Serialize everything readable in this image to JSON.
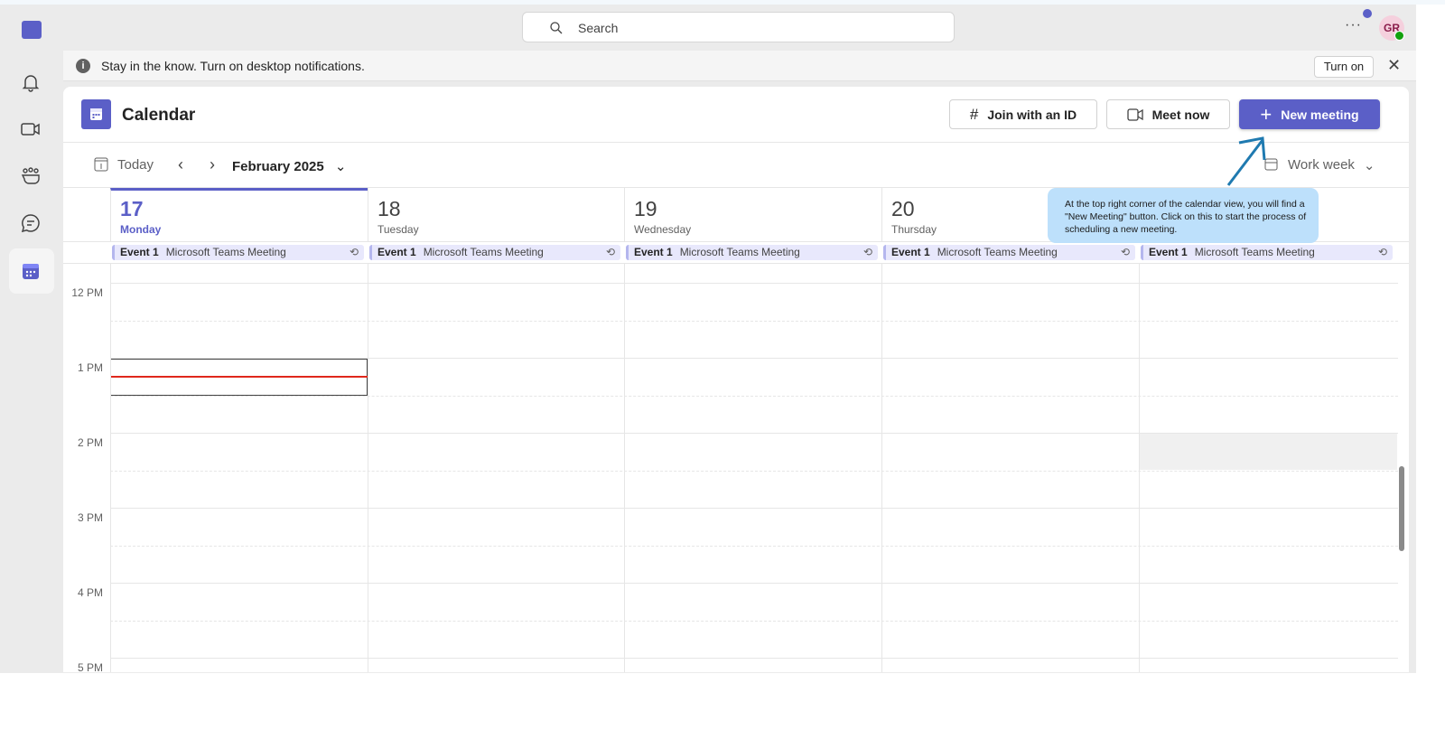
{
  "topbar": {
    "search_placeholder": "Search",
    "more": "···",
    "avatar_initials": "GR",
    "logo": "T"
  },
  "sidebar": {
    "items": [
      {
        "icon": "bell-icon",
        "label": "Activity"
      },
      {
        "icon": "video-icon",
        "label": "Meet"
      },
      {
        "icon": "people-icon",
        "label": "Communities"
      },
      {
        "icon": "chat-icon",
        "label": "Chat"
      },
      {
        "icon": "calendar-icon",
        "label": "Calendar",
        "active": true
      }
    ]
  },
  "notification": {
    "message": "Stay in the know. Turn on desktop notifications.",
    "turn_on": "Turn on",
    "close": "✕"
  },
  "header": {
    "title": "Calendar",
    "join_id": "Join with an ID",
    "meet_now": "Meet now",
    "new_meeting": "New meeting",
    "accent": "#5b5fc7"
  },
  "toolbar": {
    "today": "Today",
    "month": "February 2025",
    "view": "Work week"
  },
  "days": [
    {
      "num": "17",
      "name": "Monday",
      "current": true
    },
    {
      "num": "18",
      "name": "Tuesday"
    },
    {
      "num": "19",
      "name": "Wednesday"
    },
    {
      "num": "20",
      "name": "Thursday"
    },
    {
      "num": "",
      "name": ""
    }
  ],
  "events": [
    {
      "title": "Event 1",
      "subtitle": "Microsoft Teams Meeting"
    },
    {
      "title": "Event 1",
      "subtitle": "Microsoft Teams Meeting"
    },
    {
      "title": "Event 1",
      "subtitle": "Microsoft Teams Meeting"
    },
    {
      "title": "Event 1",
      "subtitle": "Microsoft Teams Meeting"
    },
    {
      "title": "Event 1",
      "subtitle": "Microsoft Teams Meeting"
    }
  ],
  "times": [
    "12 PM",
    "1 PM",
    "2 PM",
    "3 PM",
    "4 PM",
    "5 PM"
  ],
  "tooltip": {
    "text": "At the top right corner of the calendar view, you will find a \"New Meeting\" button. Click on this to start the process of scheduling a new meeting.",
    "color": "#bde0fb",
    "arrow_color": "#1f7ab0"
  }
}
